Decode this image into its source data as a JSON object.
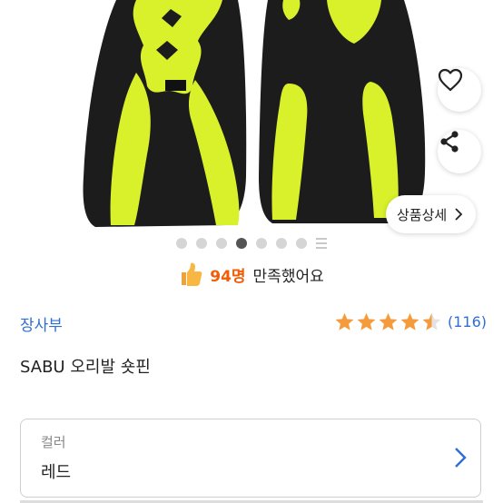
{
  "gallery": {
    "current_index": 4,
    "total_images": 7,
    "detail_button_label": "상품상세",
    "colors": {
      "fin_black": "#1c1c1c",
      "fin_yellow": "#d8f12a"
    }
  },
  "icons": {
    "like": "heart-icon",
    "share": "share-icon",
    "detail": "chevron-right-icon",
    "thumbs": "thumbs-up-icon",
    "option": "chevron-right-icon"
  },
  "satisfaction": {
    "count": "94명",
    "text": "만족했어요"
  },
  "product": {
    "brand": "장사부",
    "name": "SABU 오리발 숏핀",
    "rating": 4.5,
    "rating_max": 5,
    "review_count": "(116)",
    "star_color": "#f59b3c",
    "link_color": "#2f6fd3"
  },
  "option": {
    "label": "컬러",
    "value": "레드"
  }
}
